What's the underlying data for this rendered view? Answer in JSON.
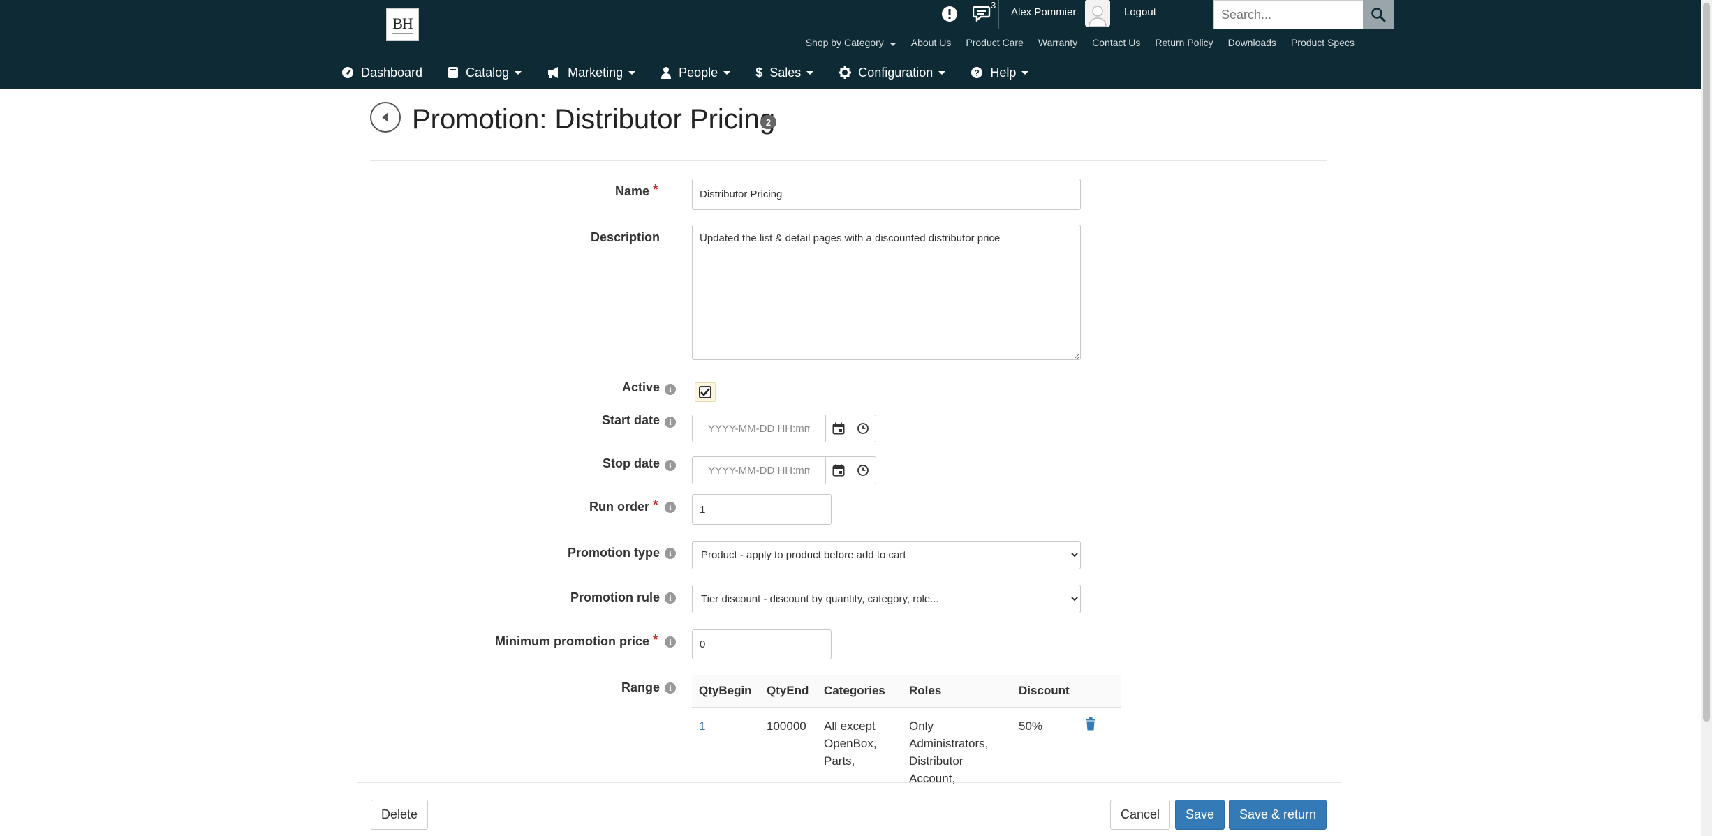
{
  "header": {
    "logo_text": "BH",
    "notification_count": "3",
    "user_name": "Alex Pommier",
    "logout_label": "Logout",
    "search_placeholder": "Search...",
    "top_links": [
      "Shop by Category",
      "About Us",
      "Product Care",
      "Warranty",
      "Contact Us",
      "Return Policy",
      "Downloads",
      "Product Specs"
    ]
  },
  "nav": {
    "items": [
      {
        "label": "Dashboard",
        "icon": "dashboard-icon"
      },
      {
        "label": "Catalog",
        "icon": "book-icon"
      },
      {
        "label": "Marketing",
        "icon": "bullhorn-icon"
      },
      {
        "label": "People",
        "icon": "user-icon"
      },
      {
        "label": "Sales",
        "icon": "dollar-icon"
      },
      {
        "label": "Configuration",
        "icon": "gear-icon"
      },
      {
        "label": "Help",
        "icon": "question-icon"
      }
    ]
  },
  "page": {
    "title": "Promotion: Distributor Pricing",
    "badge": "2"
  },
  "form": {
    "name_label": "Name",
    "name_value": "Distributor Pricing",
    "description_label": "Description",
    "description_value": "Updated the list & detail pages with a discounted distributor price",
    "active_label": "Active",
    "start_date_label": "Start date",
    "stop_date_label": "Stop date",
    "date_placeholder": "YYYY-MM-DD HH:mm",
    "run_order_label": "Run order",
    "run_order_value": "1",
    "promotion_type_label": "Promotion type",
    "promotion_type_value": "Product - apply to product before add to cart",
    "promotion_rule_label": "Promotion rule",
    "promotion_rule_value": "Tier discount - discount by quantity, category, role...",
    "min_price_label": "Minimum promotion price",
    "min_price_value": "0",
    "range_label": "Range",
    "required_mark": "*",
    "info_mark": "i"
  },
  "range_table": {
    "headers": [
      "QtyBegin",
      "QtyEnd",
      "Categories",
      "Roles",
      "Discount"
    ],
    "rows": [
      {
        "qty_begin": "1",
        "qty_end": "100000",
        "categories": "All except OpenBox, Parts,",
        "roles": "Only Administrators, Distributor Account,",
        "discount": "50%"
      }
    ]
  },
  "footer": {
    "delete_label": "Delete",
    "cancel_label": "Cancel",
    "save_label": "Save",
    "save_return_label": "Save & return"
  },
  "colors": {
    "header_bg": "#0e2a35",
    "primary": "#337ab7",
    "required": "#c9302c"
  }
}
